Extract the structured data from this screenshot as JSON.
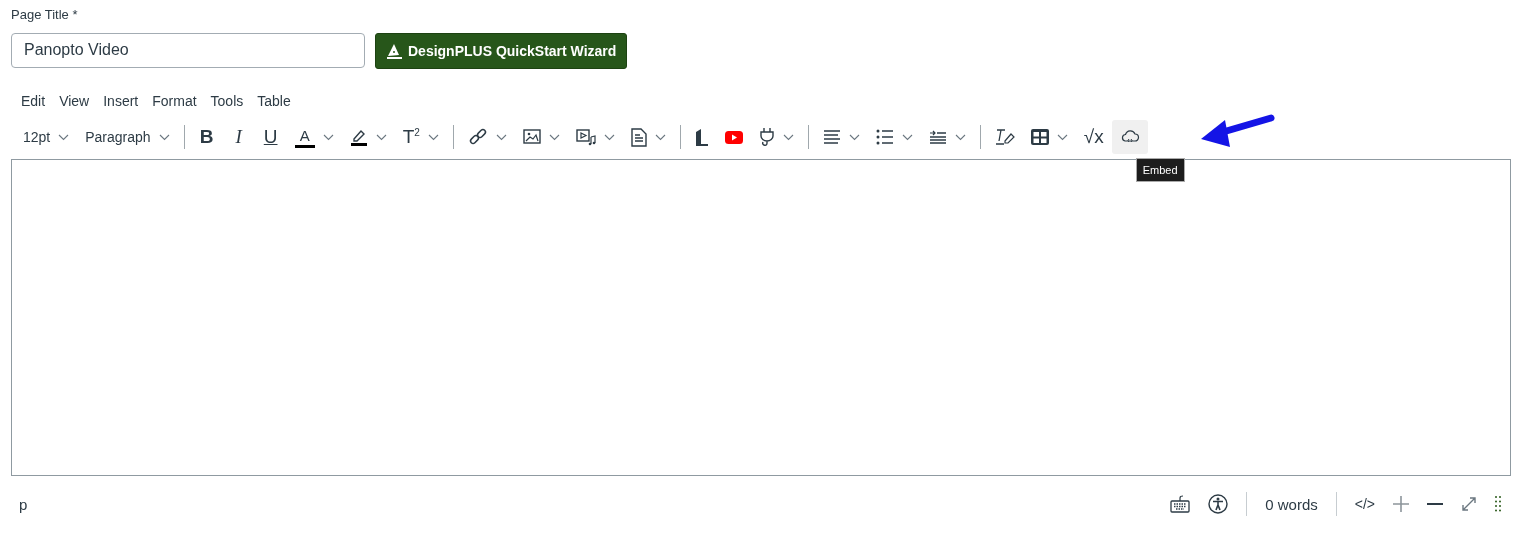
{
  "title_field": {
    "label": "Page Title",
    "required_mark": "*",
    "value": "Panopto Video"
  },
  "wizard_button": {
    "label": "DesignPLUS QuickStart Wizard"
  },
  "menubar": [
    "Edit",
    "View",
    "Insert",
    "Format",
    "Tools",
    "Table"
  ],
  "toolbar": [
    {
      "kind": "dropdown",
      "label": "12pt"
    },
    {
      "kind": "dropdown",
      "label": "Paragraph"
    },
    {
      "kind": "separator"
    },
    {
      "kind": "glyph",
      "label": "B",
      "split": false
    },
    {
      "kind": "glyph",
      "label": "I",
      "split": false
    },
    {
      "kind": "glyph",
      "label": "U",
      "split": false
    },
    {
      "kind": "glyph",
      "label": "A",
      "split": true
    },
    {
      "kind": "icon",
      "split": true
    },
    {
      "kind": "glyph",
      "label": "T$^{2}$",
      "split": true
    },
    {
      "kind": "separator"
    },
    {
      "kind": "icon",
      "split": true
    },
    {
      "kind": "icon",
      "split": true
    },
    {
      "kind": "icon",
      "split": true
    },
    {
      "kind": "icon",
      "split": true
    },
    {
      "kind": "separator"
    },
    {
      "kind": "icon",
      "split": false
    },
    {
      "kind": "icon",
      "split": false
    },
    {
      "kind": "icon",
      "split": true
    },
    {
      "kind": "separator"
    },
    {
      "kind": "icon",
      "split": true
    },
    {
      "kind": "icon",
      "split": true
    },
    {
      "kind": "icon",
      "split": true
    },
    {
      "kind": "separator"
    },
    {
      "kind": "icon",
      "split": false
    },
    {
      "kind": "icon",
      "split": true
    },
    {
      "kind": "glyph",
      "label": "√x",
      "split": false
    },
    {
      "kind": "icon",
      "split": false,
      "hovered": true,
      "tooltip": "Embed"
    }
  ],
  "status_bar": {
    "path": "p",
    "word_count": "0 words",
    "source_toggle": "</>"
  }
}
